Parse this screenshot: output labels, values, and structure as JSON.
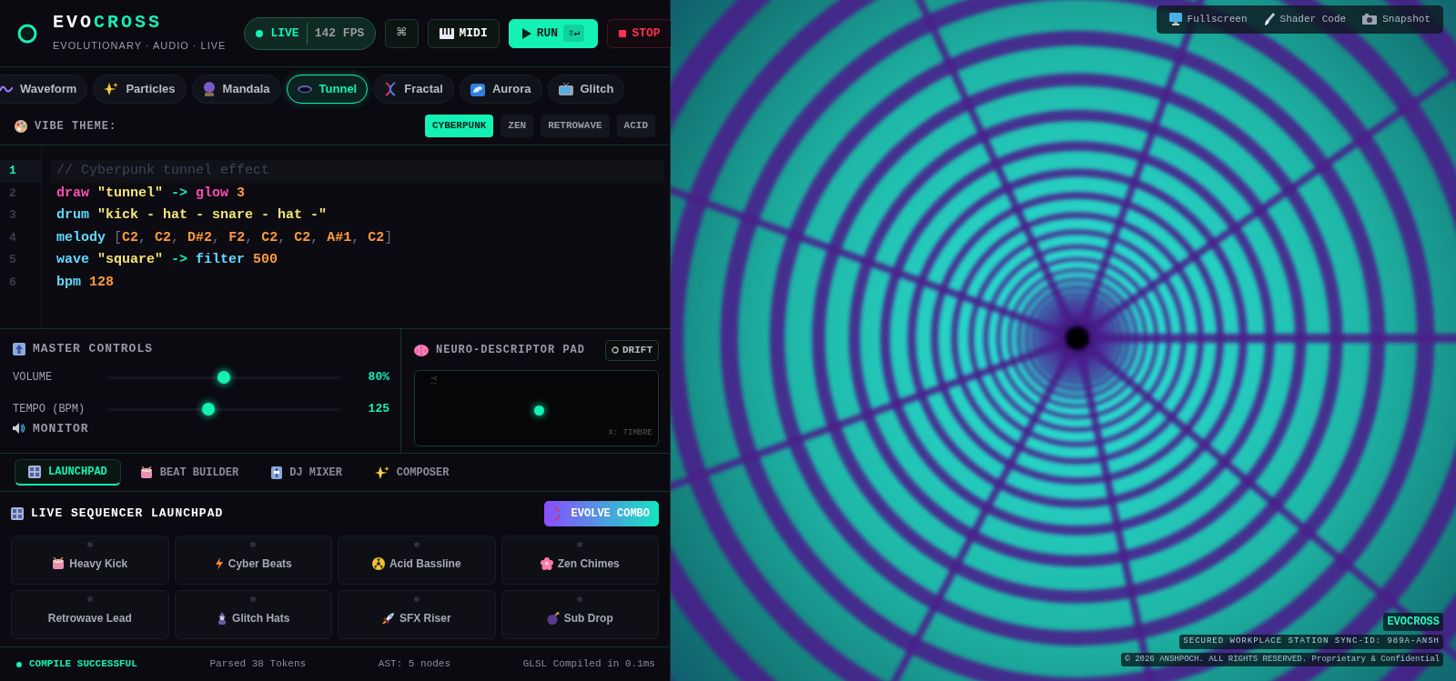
{
  "header": {
    "logo_primary": "EVO",
    "logo_accent": "CROSS",
    "subtitle": "EVOLUTIONARY · AUDIO · LIVE",
    "live": {
      "on": true,
      "label": "LIVE",
      "fps": "142 FPS"
    },
    "command_key": "⌘",
    "midi": "MIDI",
    "run": {
      "label": "RUN",
      "shortcut": "⇧↵"
    },
    "stop": "STOP"
  },
  "visual_tabs": [
    {
      "label": "Waveform",
      "selected": false
    },
    {
      "label": "Particles",
      "selected": false
    },
    {
      "label": "Mandala",
      "selected": false
    },
    {
      "label": "Tunnel",
      "selected": true
    },
    {
      "label": "Fractal",
      "selected": false
    },
    {
      "label": "Aurora",
      "selected": false
    },
    {
      "label": "Glitch",
      "selected": false
    }
  ],
  "vibe_theme": {
    "label": "VIBE THEME:",
    "options": [
      {
        "label": "CYBERPUNK",
        "selected": true
      },
      {
        "label": "ZEN",
        "selected": false
      },
      {
        "label": "RETROWAVE",
        "selected": false
      },
      {
        "label": "ACID",
        "selected": false
      }
    ]
  },
  "editor": {
    "lines": [
      {
        "number": "1",
        "active": true,
        "tokens": [
          {
            "kind": "comment",
            "text": "// Cyberpunk tunnel effect"
          }
        ]
      },
      {
        "number": "2",
        "active": false,
        "tokens": [
          {
            "kind": "visual",
            "text": "draw "
          },
          {
            "kind": "string",
            "text": "\"tunnel\" "
          },
          {
            "kind": "arrow",
            "text": "-> "
          },
          {
            "kind": "visual",
            "text": "glow "
          },
          {
            "kind": "number",
            "text": "3"
          }
        ]
      },
      {
        "number": "3",
        "active": false,
        "tokens": [
          {
            "kind": "audio",
            "text": "drum "
          },
          {
            "kind": "string",
            "text": "\"kick - hat - snare - hat -\""
          }
        ]
      },
      {
        "number": "4",
        "active": false,
        "tokens": [
          {
            "kind": "audio",
            "text": "melody "
          },
          {
            "kind": "punct",
            "text": "["
          },
          {
            "kind": "number",
            "text": "C2"
          },
          {
            "kind": "punct",
            "text": ", "
          },
          {
            "kind": "number",
            "text": "C2"
          },
          {
            "kind": "punct",
            "text": ", "
          },
          {
            "kind": "number",
            "text": "D#2"
          },
          {
            "kind": "punct",
            "text": ", "
          },
          {
            "kind": "number",
            "text": "F2"
          },
          {
            "kind": "punct",
            "text": ", "
          },
          {
            "kind": "number",
            "text": "C2"
          },
          {
            "kind": "punct",
            "text": ", "
          },
          {
            "kind": "number",
            "text": "C2"
          },
          {
            "kind": "punct",
            "text": ", "
          },
          {
            "kind": "number",
            "text": "A#1"
          },
          {
            "kind": "punct",
            "text": ", "
          },
          {
            "kind": "number",
            "text": "C2"
          },
          {
            "kind": "punct",
            "text": "]"
          }
        ]
      },
      {
        "number": "5",
        "active": false,
        "tokens": [
          {
            "kind": "audio",
            "text": "wave "
          },
          {
            "kind": "string",
            "text": "\"square\" "
          },
          {
            "kind": "arrow",
            "text": "-> "
          },
          {
            "kind": "audio",
            "text": "filter "
          },
          {
            "kind": "number",
            "text": "500"
          }
        ]
      },
      {
        "number": "6",
        "active": false,
        "tokens": [
          {
            "kind": "audio",
            "text": "bpm "
          },
          {
            "kind": "number",
            "text": "128"
          }
        ]
      }
    ]
  },
  "master_controls": {
    "title": "MASTER CONTROLS",
    "sliders": [
      {
        "label": "VOLUME",
        "level": 0.5,
        "reading": "80%"
      },
      {
        "label": "TEMPO (BPM)",
        "level": 0.43,
        "reading": "125"
      }
    ],
    "monitor": "MONITOR"
  },
  "neuro_pad": {
    "title": "NEURO-DESCRIPTOR PAD",
    "drift": "DRIFT",
    "y_axis": "Y:",
    "x_axis": "X: TIMBRE"
  },
  "tool_tabs": [
    {
      "label": "LAUNCHPAD",
      "selected": true
    },
    {
      "label": "BEAT BUILDER",
      "selected": false
    },
    {
      "label": "DJ MIXER",
      "selected": false
    },
    {
      "label": "COMPOSER",
      "selected": false
    }
  ],
  "launchpad": {
    "title": "LIVE SEQUENCER LAUNCHPAD",
    "evolve": "EVOLVE COMBO",
    "pads": [
      {
        "label": "Heavy Kick",
        "active": false
      },
      {
        "label": "Cyber Beats",
        "active": false
      },
      {
        "label": "Acid Bassline",
        "active": false
      },
      {
        "label": "Zen Chimes",
        "active": false
      },
      {
        "label": "Retrowave Lead",
        "active": false
      },
      {
        "label": "Glitch Hats",
        "active": false
      },
      {
        "label": "SFX Riser",
        "active": false
      },
      {
        "label": "Sub Drop",
        "active": false
      }
    ]
  },
  "status_bar": {
    "compile": "COMPILE SUCCESSFUL",
    "tokens": "Parsed 38 Tokens",
    "ast": "AST: 5 nodes",
    "glsl": "GLSL Compiled in 0.1ms"
  },
  "viewer_toolbar": [
    "Fullscreen",
    "Shader Code",
    "Snapshot"
  ],
  "viewer_footer": {
    "brand": "EVOCROSS",
    "sync": "SECURED WORKPLACE STATION SYNC-ID: 989A-ANSH",
    "copyright": "© 2026 ANSHPOCH. ALL RIGHTS RESERVED. Proprietary & Confidential"
  }
}
